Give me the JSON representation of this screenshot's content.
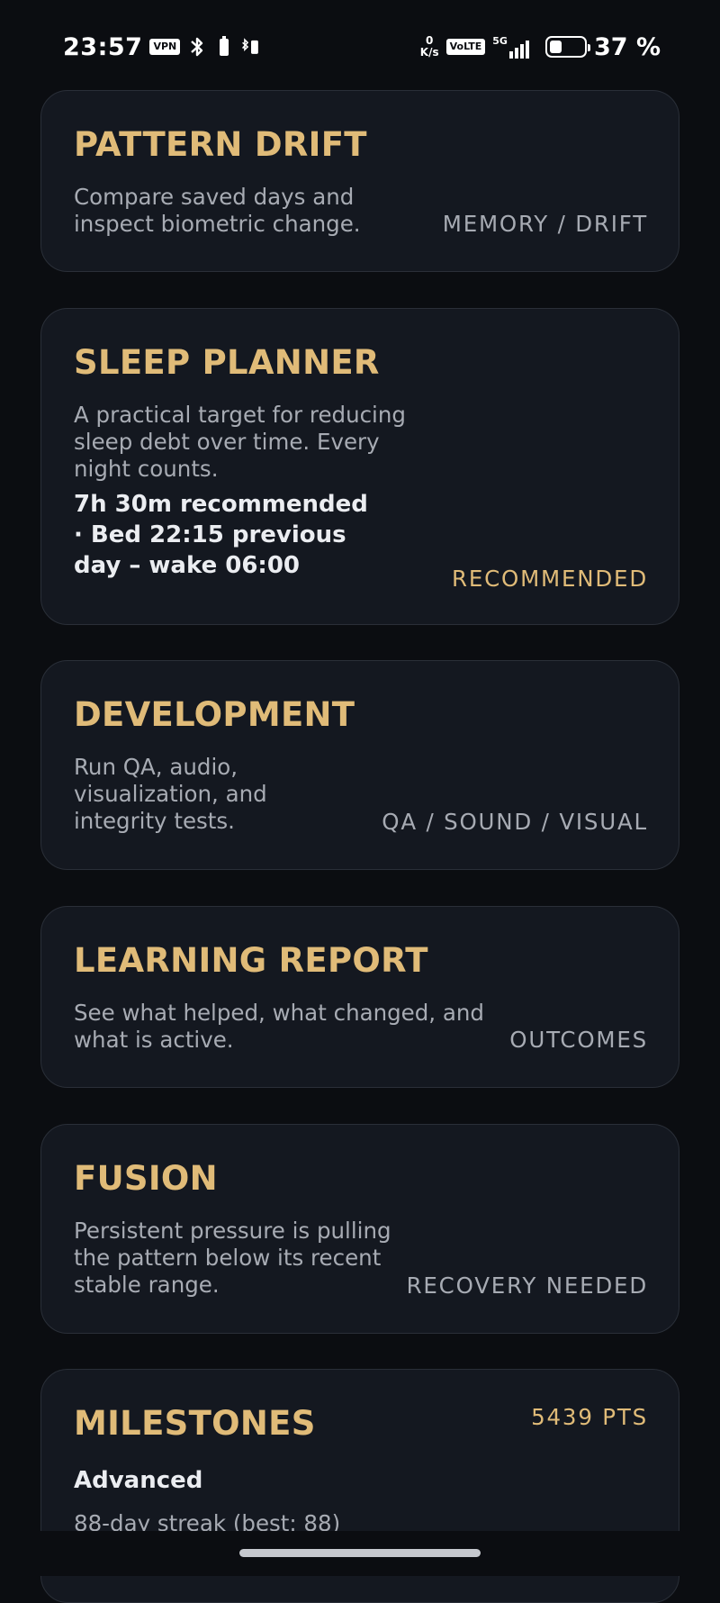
{
  "status_bar": {
    "time": "23:57",
    "vpn_label": "VPN",
    "net_speed_value": "0",
    "net_speed_unit": "K/s",
    "volte_label": "VoLTE",
    "network_label": "5G",
    "battery_percent": "37 %",
    "battery_level": 0.37
  },
  "cards": {
    "pattern_drift": {
      "title": "PATTERN DRIFT",
      "description": "Compare saved days and inspect biometric change.",
      "tag": "MEMORY / DRIFT"
    },
    "sleep_planner": {
      "title": "SLEEP PLANNER",
      "description": "A practical target for reducing sleep debt over time. Every night counts.",
      "detail": "7h 30m recommended · Bed 22:15 previous day – wake 06:00",
      "tag": "RECOMMENDED"
    },
    "development": {
      "title": "DEVELOPMENT",
      "description": "Run QA, audio, visualization, and integrity tests.",
      "tag": "QA / SOUND / VISUAL"
    },
    "learning_report": {
      "title": "LEARNING REPORT",
      "description": "See what helped, what changed, and what is active.",
      "tag": "OUTCOMES"
    },
    "fusion": {
      "title": "FUSION",
      "description": "Persistent pressure is pulling the pattern below its recent stable range.",
      "tag": "RECOVERY NEEDED"
    },
    "milestones": {
      "title": "MILESTONES",
      "points": "5439 PTS",
      "level": "Advanced",
      "streak": "88-day streak (best: 88)"
    }
  },
  "colors": {
    "background": "#0b0d11",
    "card": "#141820",
    "accent_gold": "#e0bb78",
    "muted_text": "#a7abb3"
  }
}
